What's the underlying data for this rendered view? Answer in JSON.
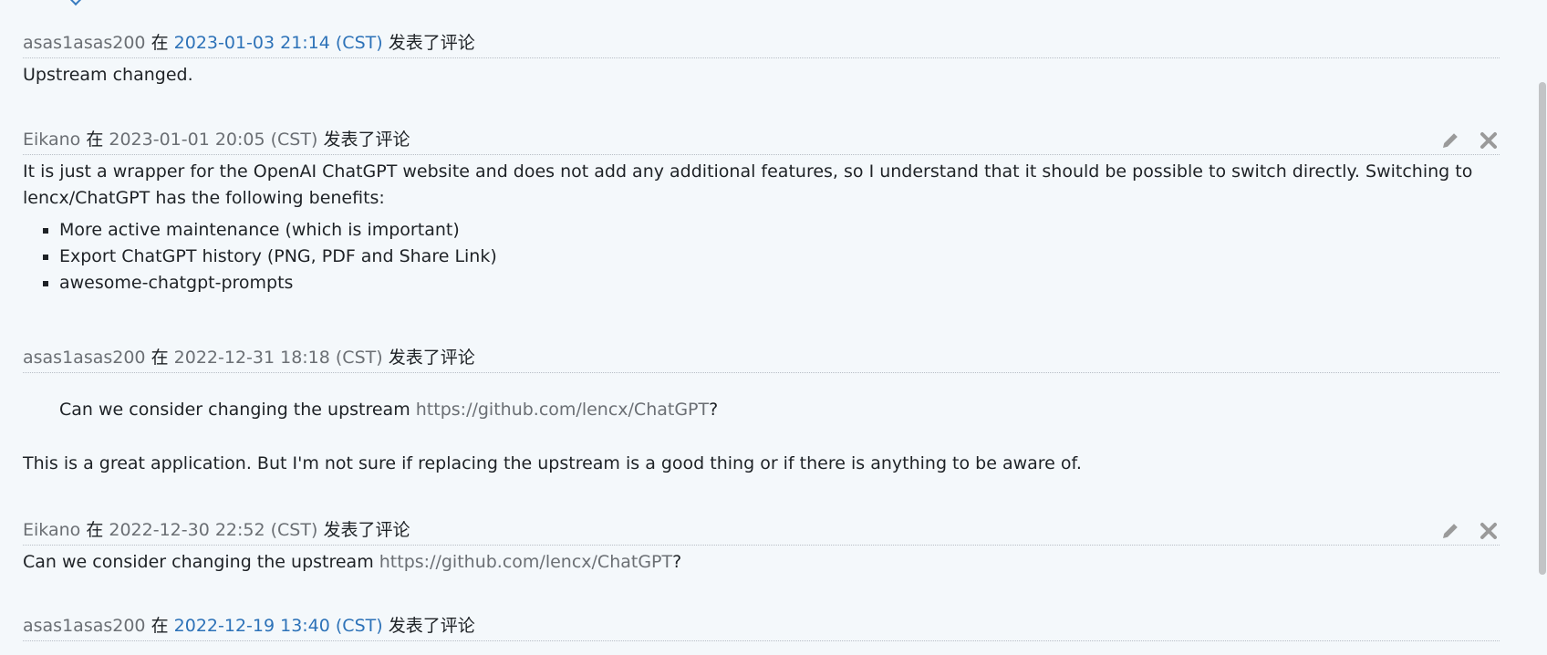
{
  "comments": [
    {
      "author": "asas1asas200",
      "at": "在",
      "date": "2023-01-03 21:14 (CST)",
      "verb": "发表了评论",
      "text": "Upstream changed."
    },
    {
      "author": "Eikano",
      "at": "在",
      "date": "2023-01-01 20:05 (CST)",
      "verb": "发表了评论",
      "text": "It is just a wrapper for the OpenAI ChatGPT website and does not add any additional features, so I understand that it should be possible to switch directly. Switching to lencx/ChatGPT has the following benefits:",
      "list": [
        "More active maintenance (which is important)",
        "Export ChatGPT history (PNG, PDF and Share Link)",
        "awesome-chatgpt-prompts"
      ]
    },
    {
      "author": "asas1asas200",
      "at": "在",
      "date": "2022-12-31 18:18 (CST)",
      "verb": "发表了评论",
      "quote_prefix": "Can we consider changing the upstream ",
      "quote_link": "https://github.com/lencx/ChatGPT",
      "quote_suffix": "?",
      "text": "This is a great application. But I'm not sure if replacing the upstream is a good thing or if there is anything to be aware of."
    },
    {
      "author": "Eikano",
      "at": "在",
      "date": "2022-12-30 22:52 (CST)",
      "verb": "发表了评论",
      "text_prefix": "Can we consider changing the upstream ",
      "link": "https://github.com/lencx/ChatGPT",
      "text_suffix": "?"
    },
    {
      "author": "asas1asas200",
      "at": "在",
      "date": "2022-12-19 13:40 (CST)",
      "verb": "发表了评论"
    }
  ],
  "icons": {
    "edit": "pencil-icon",
    "delete": "close-icon"
  },
  "colors": {
    "background": "#f4f8fb",
    "link": "#2d72b8",
    "muted": "#6b6f74",
    "text": "#1e2226",
    "icon": "#9a9a9a"
  }
}
